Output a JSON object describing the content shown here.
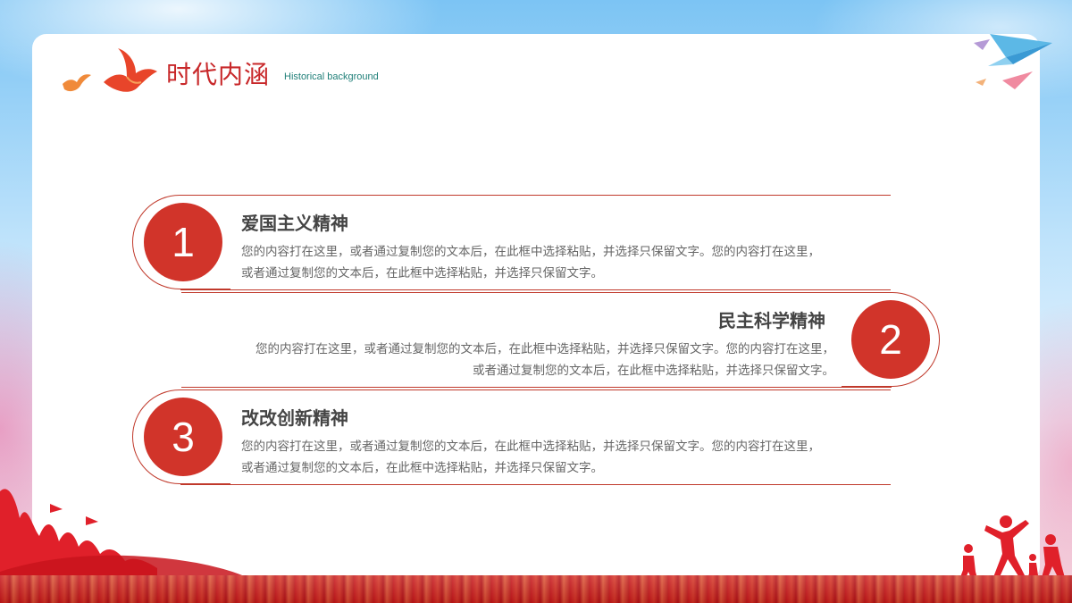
{
  "header": {
    "title": "时代内涵",
    "subtitle": "Historical background"
  },
  "items": [
    {
      "number": "1",
      "heading": "爱国主义精神",
      "line1": "您的内容打在这里，或者通过复制您的文本后，在此框中选择粘贴，并选择只保留文字。您的内容打在这里，",
      "line2": "或者通过复制您的文本后，在此框中选择粘贴，并选择只保留文字。"
    },
    {
      "number": "2",
      "heading": "民主科学精神",
      "line1": "您的内容打在这里，或者通过复制您的文本后，在此框中选择粘贴，并选择只保留文字。您的内容打在这里，",
      "line2": "或者通过复制您的文本后，在此框中选择粘贴，并选择只保留文字。"
    },
    {
      "number": "3",
      "heading": "改改创新精神",
      "line1": "您的内容打在这里，或者通过复制您的文本后，在此框中选择粘贴，并选择只保留文字。您的内容打在这里，",
      "line2": "或者通过复制您的文本后，在此框中选择粘贴，并选择只保留文字。"
    }
  ],
  "colors": {
    "accent": "#d1342a",
    "line": "#c0392b",
    "title": "#c8282a",
    "subtitle": "#1f7f78"
  },
  "icons": [
    "dove-icon",
    "small-dove-icon",
    "paper-plane-icon",
    "crowd-silhouette-icon",
    "runners-silhouette-icon"
  ]
}
